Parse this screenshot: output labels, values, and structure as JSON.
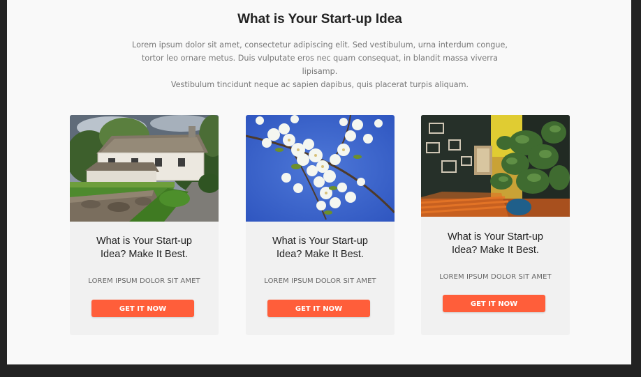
{
  "section": {
    "title": "What is Your Start-up Idea",
    "intro_lines": [
      "Lorem ipsum dolor sit amet, consectetur adipiscing elit. Sed vestibulum, urna interdum congue,",
      "tortor leo ornare metus. Duis vulputate eros nec quam consequat, in blandit massa viverra lipisamp.",
      "Vestibulum tincidunt neque ac sapien dapibus, quis placerat turpis aliquam."
    ]
  },
  "cards": [
    {
      "image": "stone-cottage-photo",
      "heading_lines": [
        "What is Your Start-up",
        "Idea? Make It Best."
      ],
      "subtitle": "LOREM IPSUM DOLOR SIT AMET",
      "button_label": "GET IT NOW"
    },
    {
      "image": "white-blossoms-photo",
      "heading_lines": [
        "What is Your Start-up",
        "Idea? Make It Best."
      ],
      "subtitle": "LOREM IPSUM DOLOR SIT AMET",
      "button_label": "GET IT NOW"
    },
    {
      "image": "room-plant-photo",
      "heading_lines": [
        "What is Your Start-up",
        "Idea? Make It Best."
      ],
      "subtitle": "LOREM IPSUM DOLOR SIT AMET",
      "button_label": "GET IT NOW"
    }
  ],
  "colors": {
    "accent": "#ff5e3a",
    "page_bg": "#f9f9f9",
    "card_bg": "#f1f1f1",
    "frame": "#232323"
  }
}
